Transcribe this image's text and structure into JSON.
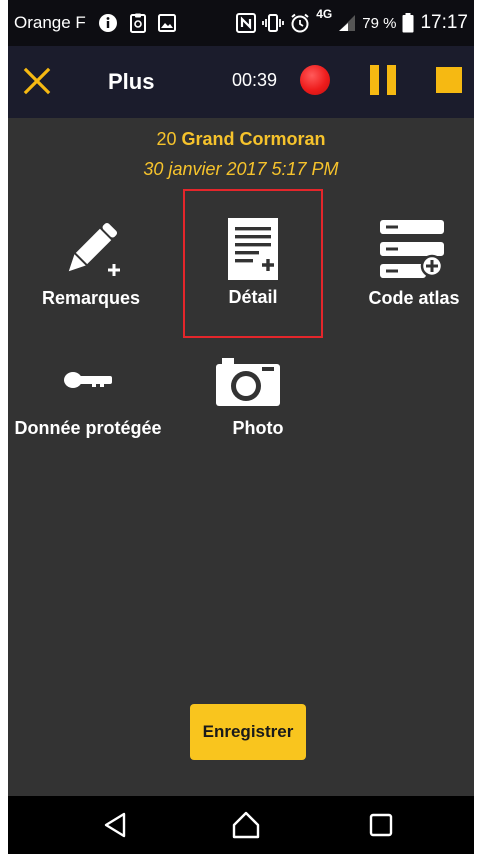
{
  "status_bar": {
    "carrier": "Orange F",
    "network": "4G",
    "battery": "79 %",
    "time": "17:17",
    "icons": [
      "info-icon",
      "clipboard-icon",
      "image-icon",
      "nfc-icon",
      "vibrate-icon",
      "alarm-icon",
      "signal-icon",
      "battery-icon"
    ]
  },
  "app_bar": {
    "title": "Plus",
    "timer": "00:39",
    "icons": [
      "close-icon",
      "record-icon",
      "pause-icon",
      "stop-icon"
    ],
    "accent": "#f6b912",
    "record_color": "#ee1c1c"
  },
  "observation": {
    "count": "20",
    "species": "Grand Cormoran",
    "datetime": "30 janvier 2017 5:17 PM",
    "text_color": "#f6c32c"
  },
  "actions": [
    {
      "label": "Remarques",
      "icon": "pencil-plus-icon"
    },
    {
      "label": "Détail",
      "icon": "document-plus-icon",
      "selected": true
    },
    {
      "label": "Code atlas",
      "icon": "list-plus-icon"
    },
    {
      "label": "Donnée protégée",
      "icon": "key-icon"
    },
    {
      "label": "Photo",
      "icon": "camera-icon"
    }
  ],
  "save_button": {
    "label": "Enregistrer"
  },
  "nav_bar": {
    "icons": [
      "back-icon",
      "home-icon",
      "recents-icon"
    ]
  }
}
